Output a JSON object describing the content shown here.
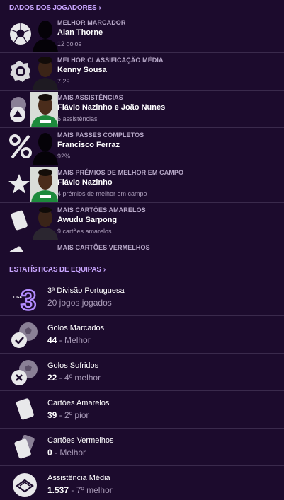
{
  "players_section": {
    "title": "DADOS DOS JOGADORES",
    "chevron": "›"
  },
  "player_stats": [
    {
      "label": "MELHOR MARCADOR",
      "name": "Alan Thorne",
      "detail": "12 golos",
      "icon": "football-icon",
      "face": "silhouette"
    },
    {
      "label": "MELHOR CLASSIFICAÇÃO MÉDIA",
      "name": "Kenny Sousa",
      "detail": "7,29",
      "icon": "rating-badge-icon",
      "face": "player"
    },
    {
      "label": "MAIS ASSISTÊNCIAS",
      "name": "Flávio Nazinho e João Nunes",
      "detail": "6 assistências",
      "icon": "assist-icon",
      "face": "player"
    },
    {
      "label": "MAIS PASSES COMPLETOS",
      "name": "Francisco Ferraz",
      "detail": "92%",
      "icon": "percent-icon",
      "face": "silhouette"
    },
    {
      "label": "MAIS PRÉMIOS DE MELHOR EM CAMPO",
      "name": "Flávio Nazinho",
      "detail": "4 prémios de melhor em campo",
      "icon": "star-icon",
      "face": "player"
    },
    {
      "label": "MAIS CARTÕES AMARELOS",
      "name": "Awudu Sarpong",
      "detail": "9 cartões amarelos",
      "icon": "card-icon",
      "face": "player"
    },
    {
      "label": "MAIS CARTÕES VERMELHOS",
      "name": "",
      "detail": "",
      "icon": "card-icon",
      "face": "none"
    }
  ],
  "teams_section": {
    "title": "ESTATÍSTICAS DE EQUIPAS",
    "chevron": "›"
  },
  "team_stats": [
    {
      "label": "3ª Divisão Portuguesa",
      "value": "20 jogos jogados",
      "suffix": "",
      "icon": "league-3-logo"
    },
    {
      "label": "Golos Marcados",
      "value": "44",
      "suffix": " - Melhor",
      "icon": "goals-scored-icon"
    },
    {
      "label": "Golos Sofridos",
      "value": "22",
      "suffix": " - 4º melhor",
      "icon": "goals-conceded-icon"
    },
    {
      "label": "Cartões Amarelos",
      "value": "39",
      "suffix": " - 2º pior",
      "icon": "yellow-card-icon"
    },
    {
      "label": "Cartões Vermelhos",
      "value": "0",
      "suffix": " - Melhor",
      "icon": "red-card-icon"
    },
    {
      "label": "Assistência Média",
      "value": "1.537",
      "suffix": " - 7º melhor",
      "icon": "attendance-icon"
    }
  ],
  "league_logo_text": {
    "small": "LIGA",
    "number": "3"
  }
}
